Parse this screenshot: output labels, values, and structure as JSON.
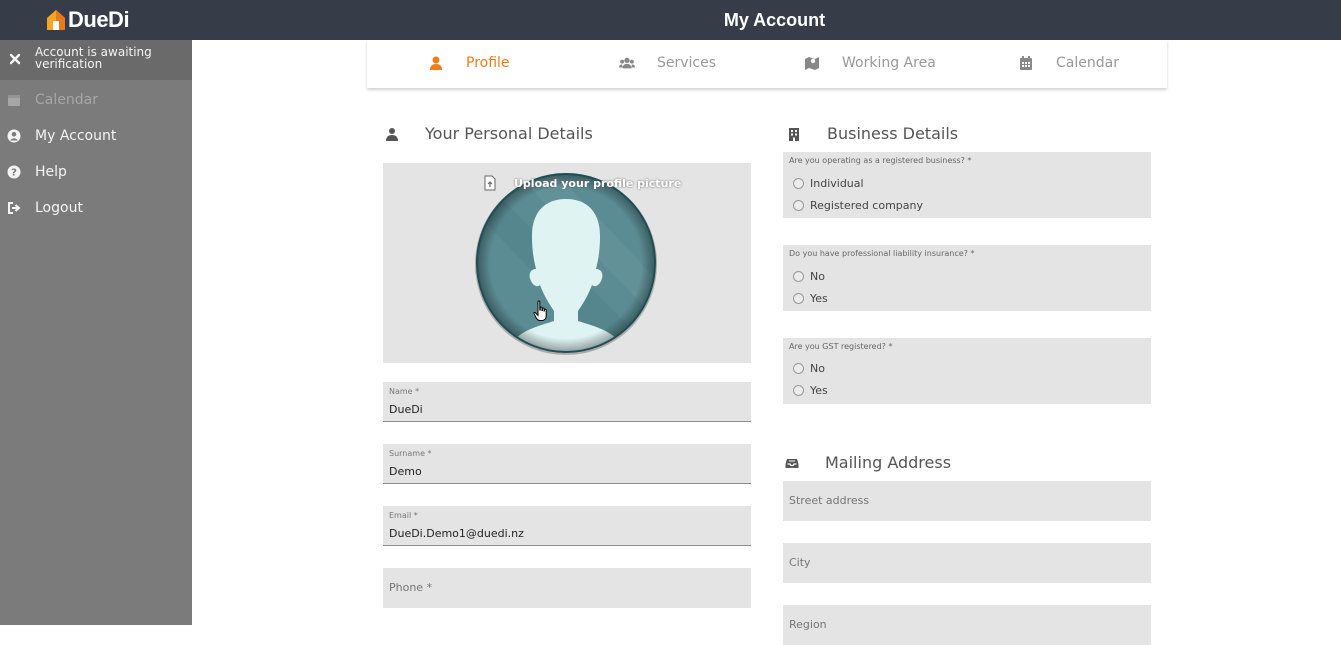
{
  "app": {
    "logo_text": "DueDi",
    "title": "My Account"
  },
  "sidebar": {
    "notice": "Account is awaiting verification",
    "items": [
      {
        "label": "Calendar",
        "icon": "calendar-icon",
        "disabled": true
      },
      {
        "label": "My Account",
        "icon": "user-circle-icon"
      },
      {
        "label": "Help",
        "icon": "question-circle-icon"
      },
      {
        "label": "Logout",
        "icon": "sign-out-icon"
      }
    ]
  },
  "tabs": [
    {
      "label": "Profile",
      "icon": "user-icon",
      "active": true
    },
    {
      "label": "Services",
      "icon": "users-icon"
    },
    {
      "label": "Working Area",
      "icon": "map-icon"
    },
    {
      "label": "Calendar",
      "icon": "calendar-icon"
    }
  ],
  "personal": {
    "heading": "Your Personal Details",
    "upload_label": "Upload your profile picture",
    "name": {
      "label": "Name *",
      "value": "DueDi"
    },
    "surname": {
      "label": "Surname *",
      "value": "Demo"
    },
    "email": {
      "label": "Email *",
      "value": "DueDi.Demo1@duedi.nz"
    },
    "phone": {
      "placeholder": "Phone *"
    }
  },
  "business": {
    "heading": "Business Details",
    "q1": {
      "question": "Are you operating as a registered business? *",
      "options": [
        "Individual",
        "Registered company"
      ]
    },
    "q2": {
      "question": "Do you have professional liability insurance? *",
      "options": [
        "No",
        "Yes"
      ]
    },
    "q3": {
      "question": "Are you GST registered? *",
      "options": [
        "No",
        "Yes"
      ]
    }
  },
  "mailing": {
    "heading": "Mailing Address",
    "street": {
      "placeholder": "Street address"
    },
    "city": {
      "placeholder": "City"
    },
    "region": {
      "placeholder": "Region"
    }
  },
  "colors": {
    "topbar": "#373d48",
    "accent": "#ee7d1a",
    "sidebar": "#7b7b7b",
    "field_bg": "#e4e4e4"
  }
}
